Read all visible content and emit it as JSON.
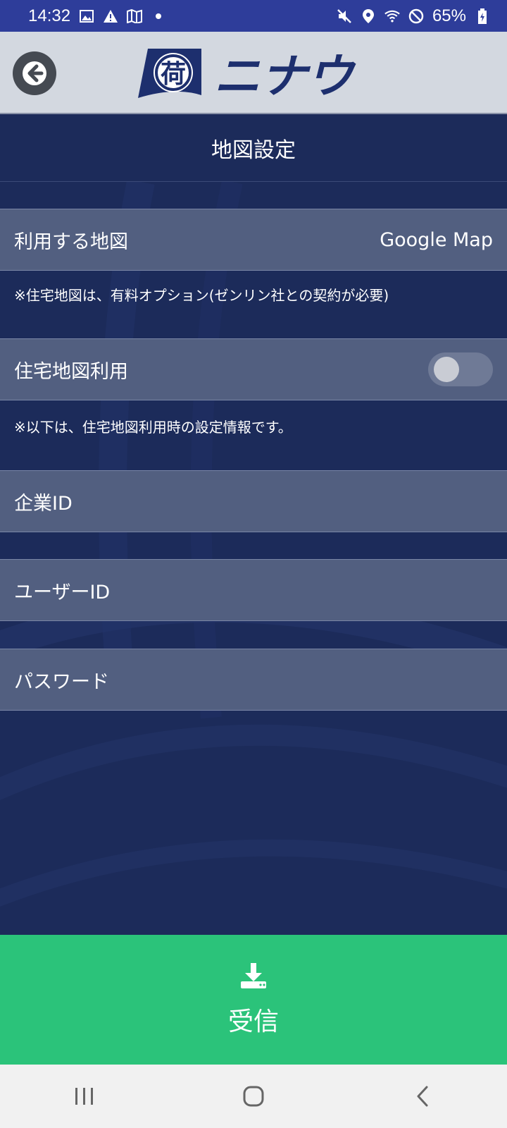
{
  "status_bar": {
    "time": "14:32",
    "battery": "65%"
  },
  "header": {
    "logo_text": "ニナウ",
    "logo_mark": "荷"
  },
  "page": {
    "title": "地図設定"
  },
  "settings": {
    "map_label": "利用する地図",
    "map_value": "Google Map",
    "map_note": "※住宅地図は、有料オプション(ゼンリン社との契約が必要)",
    "residential_label": "住宅地図利用",
    "residential_enabled": false,
    "residential_note": "※以下は、住宅地図利用時の設定情報です。",
    "company_id_label": "企業ID",
    "user_id_label": "ユーザーID",
    "password_label": "パスワード"
  },
  "receive_button": {
    "label": "受信",
    "icon": "download-icon"
  },
  "colors": {
    "status_bar": "#2e3d9a",
    "header": "#d3d8e0",
    "background": "#1c2b5a",
    "row": "#525f80",
    "accent_green": "#2bc37a",
    "logo_navy": "#1d2f6e"
  }
}
